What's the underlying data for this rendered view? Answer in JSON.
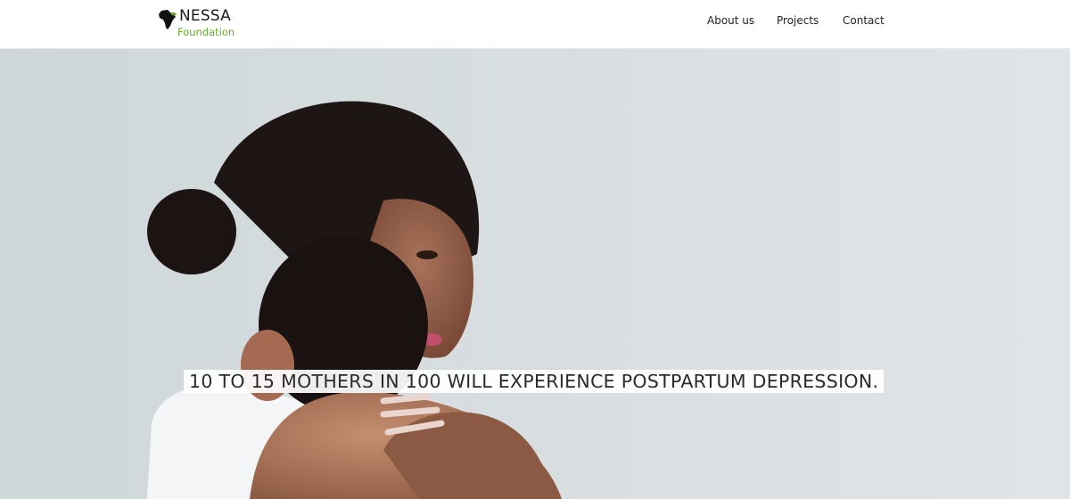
{
  "header": {
    "logo": {
      "title": "NESSA",
      "subtitle": "Foundation",
      "icon": "africa-map-icon",
      "accent_color": "#6aa82e"
    },
    "nav": [
      {
        "label": "About us"
      },
      {
        "label": "Projects"
      },
      {
        "label": "Contact"
      }
    ]
  },
  "hero": {
    "image": "mother-hugging-baby-photo",
    "background_color": "#d5dbde",
    "headline": "10 TO 15 MOTHERS IN 100 WILL EXPERIENCE POSTPARTUM DEPRESSION."
  }
}
